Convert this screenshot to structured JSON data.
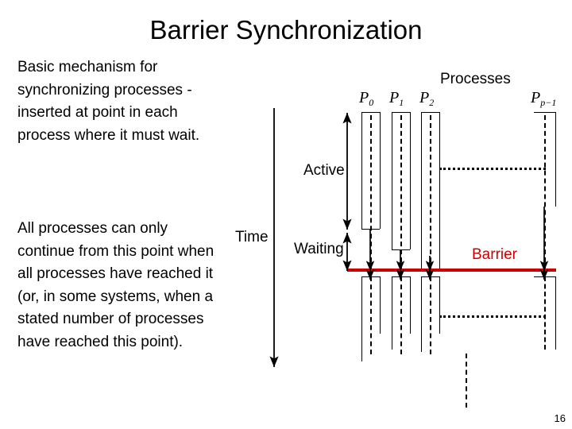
{
  "slide": {
    "title": "Barrier Synchronization",
    "page_number": "16",
    "paragraphs": {
      "first": "Basic mechanism for synchronizing processes - inserted at point in each process where it must wait.",
      "second": "All processes can only continue from this point when all processes have reached it (or, in some systems, when a stated number of processes have reached this point)."
    }
  },
  "diagram": {
    "header": "Processes",
    "time_axis_label": "Time",
    "active_label": "Active",
    "waiting_label": "Waiting",
    "barrier_label": "Barrier",
    "processes": [
      {
        "name": "P0",
        "base": "P",
        "sub": "0"
      },
      {
        "name": "P1",
        "base": "P",
        "sub": "1"
      },
      {
        "name": "P2",
        "base": "P",
        "sub": "2"
      },
      {
        "name": "Pp-1",
        "base": "P",
        "sub": "p−1"
      }
    ],
    "colors": {
      "barrier": "#CC0000",
      "line": "#000000",
      "background": "#FFFFFF"
    }
  }
}
